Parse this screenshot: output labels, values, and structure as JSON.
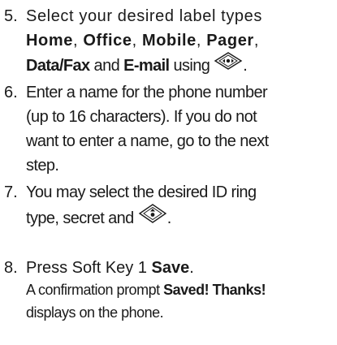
{
  "steps": [
    {
      "number": "5.",
      "line1": "Select your desired label types",
      "labels": [
        "Home",
        "Office",
        "Mobile",
        "Pager",
        "Data/Fax",
        "E-mail"
      ],
      "sep": ",",
      "and": "and",
      "using": "using",
      "end": "."
    },
    {
      "number": "6.",
      "lines": [
        "Enter a name for the phone number",
        "(up to 16 characters). If you do not",
        "want to enter a name, go to the next",
        "step."
      ]
    },
    {
      "number": "7.",
      "lines": [
        "You may select the desired ID ring",
        "type, secret and"
      ],
      "end": "."
    },
    {
      "number": "8.",
      "prefix": "Press Soft Key 1",
      "key": "Save",
      "end": ".",
      "note_prefix": "A confirmation prompt",
      "note_bold": "Saved! Thanks!",
      "note_line2": "displays on the phone."
    }
  ],
  "icons": {
    "nav_left_right": "nav-key-left-right-icon",
    "nav_ok": "nav-key-ok-icon"
  }
}
